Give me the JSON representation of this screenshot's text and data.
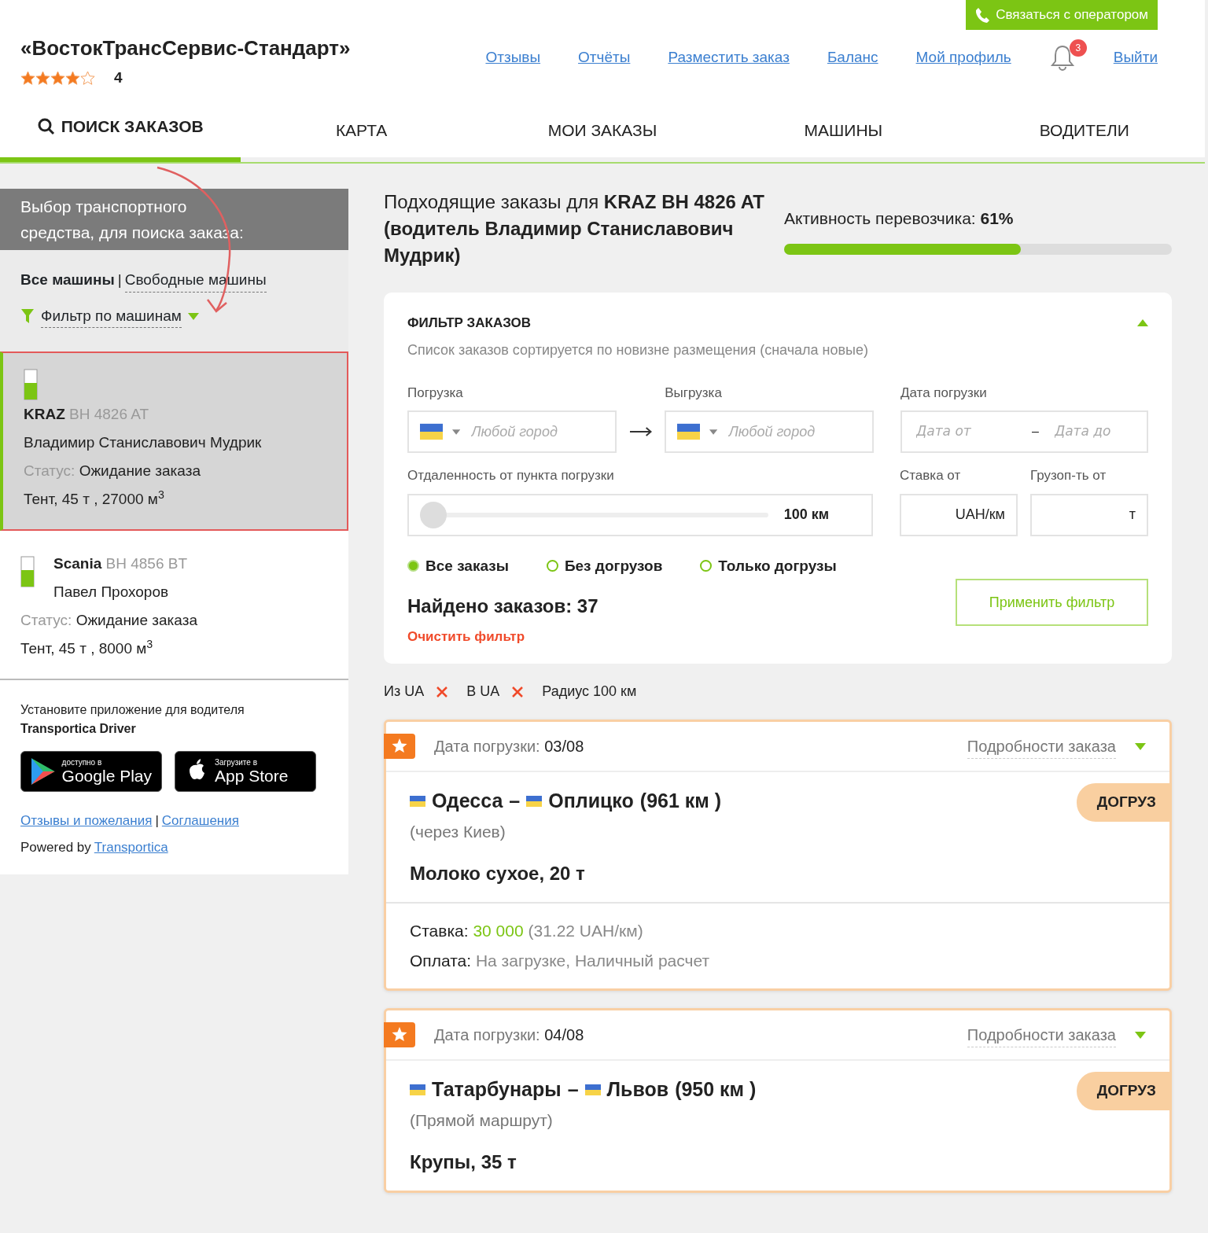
{
  "header": {
    "company": "«ВостокТрансСервис-Стандарт»",
    "stars": 4,
    "rating": "4",
    "contact_button": "Связаться с оператором",
    "links": [
      "Отзывы",
      "Отчёты",
      "Разместить заказ",
      "Баланс",
      "Мой профиль"
    ],
    "notifications": "3",
    "logout": "Выйти"
  },
  "tabs": [
    {
      "label": "ПОИСК ЗАКАЗОВ",
      "selected": true
    },
    {
      "label": "КАРТА",
      "selected": false
    },
    {
      "label": "МОИ ЗАКАЗЫ",
      "selected": false
    },
    {
      "label": "МАШИНЫ",
      "selected": false
    },
    {
      "label": "ВОДИТЕЛИ",
      "selected": false
    }
  ],
  "sidebar": {
    "title": "Выбор транспортного средства, для поиска заказа:",
    "filters": [
      {
        "label": "Все машины",
        "selected": true
      },
      {
        "label": "Свободные машины",
        "selected": false
      }
    ],
    "separator": "|",
    "vehicle_filter": "Фильтр по машинам",
    "vehicles": [
      {
        "make": "KRAZ",
        "plate": "BH 4826 AT",
        "driver": "Владимир Станиславович Мудрик",
        "status_label": "Статус:",
        "status": "Ожидание заказа",
        "specs": "Тент, 45 т , 27000 м$^{3}$",
        "selected": true
      },
      {
        "make": "Scania",
        "plate": "BH 4856 BT",
        "driver": "Павел Прохоров",
        "status_label": "Статус:",
        "status": "Ожидание заказа",
        "specs": "Тент, 45 т , 8000 м$^{3}$",
        "selected": false
      }
    ],
    "app_promo": "Установите приложение для водителя",
    "app_name": "Transportica Driver",
    "store_badges": [
      {
        "kind": "google",
        "small": "доступно в",
        "name": "Google Play"
      },
      {
        "kind": "apple",
        "small": "Загрузите в",
        "name": "App Store"
      }
    ],
    "footer_links": [
      "Отзывы и пожелания",
      "Соглашения"
    ],
    "footer_separator": "|",
    "powered_by": "Powered by",
    "powered_link": "Transportica"
  },
  "main": {
    "heading": "Подходящие заказы для **KRAZ BH 4826 AT (водитель Владимир Станиславович Мудрик)**",
    "activity": {
      "label": "Активность перевозчика: **61%**",
      "level": 0.61
    },
    "filter": {
      "title": "ФИЛЬТР ЗАКАЗОВ",
      "expanded": true,
      "subtitle": "Список заказов сортируется по новизне размещения (сначала новые)",
      "loading": {
        "label": "Погрузка",
        "placeholder": "Любой город"
      },
      "unloading": {
        "label": "Выгрузка",
        "placeholder": "Любой город"
      },
      "date": {
        "label": "Дата погрузки",
        "from_placeholder": "Дата от",
        "separator": "–",
        "to_placeholder": "Дата до"
      },
      "distance": {
        "label": "Отдаленность от пункта погрузки",
        "level": 0,
        "reading": "100 км"
      },
      "rate": {
        "label": "Ставка от",
        "unit": "UAH/км"
      },
      "capacity": {
        "label": "Грузоп-ть от",
        "unit": "т"
      },
      "options": [
        {
          "label": "Все заказы",
          "selected": true
        },
        {
          "label": "Без догрузов",
          "selected": false
        },
        {
          "label": "Только догрузы",
          "selected": false
        }
      ],
      "found": "Найдено заказов: 37",
      "clear": "Очистить фильтр",
      "apply": "Применить фильтр"
    },
    "active_filters": [
      {
        "label": "Из UA",
        "removable": true
      },
      {
        "label": "В UA",
        "removable": true
      },
      {
        "label": "Радиус 100 км",
        "removable": false
      }
    ],
    "orders": [
      {
        "date_label": "Дата погрузки:",
        "date": "03/08",
        "details": "Подробности заказа",
        "from": "Одесса",
        "dash": "–",
        "to": "Оплицко",
        "distance": "(961 км )",
        "route": "(через Киев)",
        "cargo": "Молоко сухое, 20 т",
        "badge": "ДОГРУЗ",
        "rate_label": "Ставка:",
        "rate": "30 000",
        "rate_per_km": "(31.22 UAH/км)",
        "payment_label": "Оплата:",
        "payment": "На загрузке, Наличный расчет"
      },
      {
        "date_label": "Дата погрузки:",
        "date": "04/08",
        "details": "Подробности заказа",
        "from": "Татарбунары",
        "dash": "–",
        "to": "Львов",
        "distance": "(950 км )",
        "route": "(Прямой маршрут)",
        "cargo": "Крупы, 35 т",
        "badge": "ДОГРУЗ"
      }
    ]
  }
}
